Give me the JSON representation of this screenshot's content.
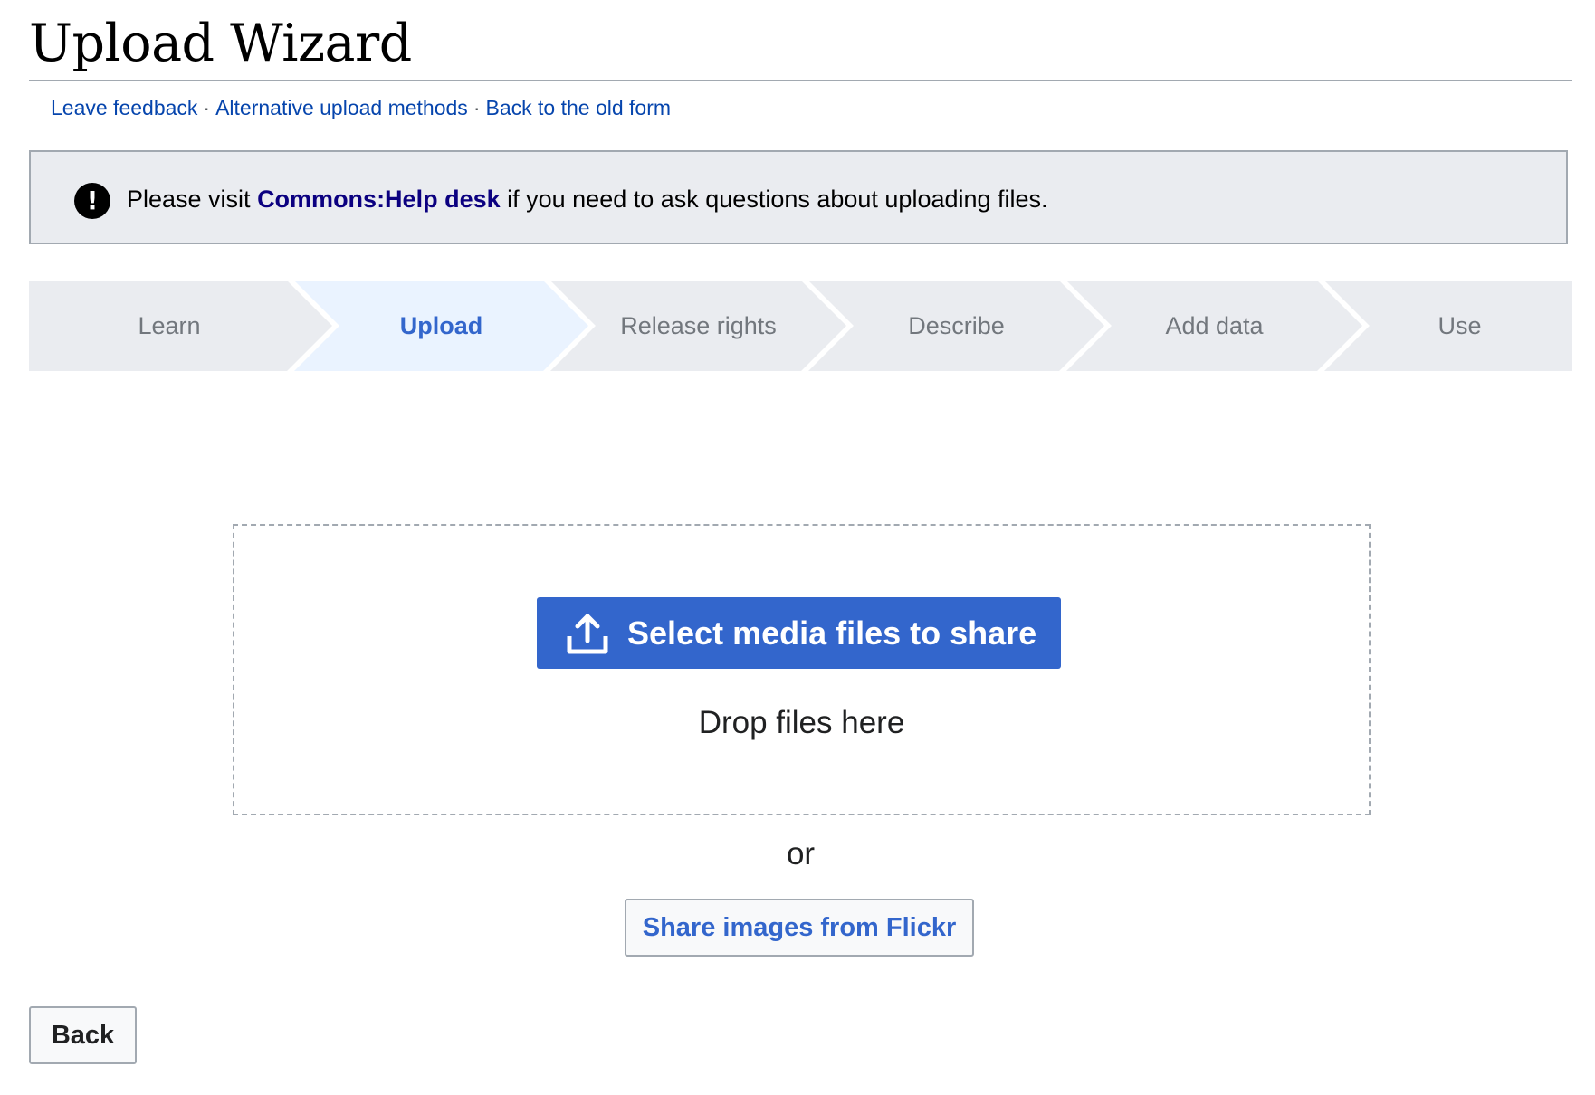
{
  "header": {
    "title": "Upload Wizard",
    "links": [
      {
        "label": "Leave feedback"
      },
      {
        "label": "Alternative upload methods"
      },
      {
        "label": "Back to the old form"
      }
    ],
    "separator": "·"
  },
  "notice": {
    "icon": "exclamation-icon",
    "text_before": "Please visit ",
    "link_label": "Commons:Help desk",
    "text_after": " if you need to ask questions about uploading files."
  },
  "steps": {
    "active_index": 1,
    "colors": {
      "inactive_bg": "#eaecf0",
      "active_bg": "#eaf3ff",
      "active_text": "#3366cc",
      "inactive_text": "#72777d"
    },
    "items": [
      {
        "label": "Learn"
      },
      {
        "label": "Upload"
      },
      {
        "label": "Release rights"
      },
      {
        "label": "Describe"
      },
      {
        "label": "Add data"
      },
      {
        "label": "Use"
      }
    ]
  },
  "dropzone": {
    "select_button_label": "Select media files to share",
    "select_button_icon": "upload-icon",
    "drop_text": "Drop files here"
  },
  "or_text": "or",
  "flickr_button_label": "Share images from Flickr",
  "back_button_label": "Back",
  "colors": {
    "accent": "#3366cc",
    "link": "#0645ad",
    "notice_bg": "#eaecf0",
    "border": "#a2a9b1"
  }
}
